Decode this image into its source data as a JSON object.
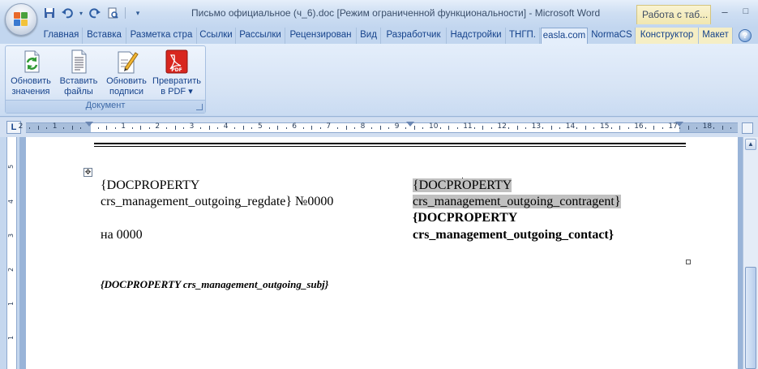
{
  "window": {
    "title": "Письмо официальное (ч_6).doc [Режим ограниченной функциональности] - Microsoft Word",
    "contextual_tab_header": "Работа с таб...",
    "controls": {
      "minimize": "–",
      "maximize": "□"
    }
  },
  "quick_access": [
    "save-icon",
    "undo-icon",
    "redo-icon",
    "print-preview-icon",
    "customize-icon"
  ],
  "tabs": [
    "Главная",
    "Вставка",
    "Разметка стра",
    "Ссылки",
    "Рассылки",
    "Рецензирован",
    "Вид",
    "Разработчик",
    "Надстройки",
    "ТНГП.",
    "easla.com",
    "NormaCS",
    "Конструктор",
    "Макет"
  ],
  "active_tab": "easla.com",
  "help_label": "?",
  "ribbon": {
    "group_label": "Документ",
    "buttons": [
      {
        "line1": "Обновить",
        "line2": "значения",
        "icon": "refresh-values-icon"
      },
      {
        "line1": "Вставить",
        "line2": "файлы",
        "icon": "insert-files-icon"
      },
      {
        "line1": "Обновить",
        "line2": "подписи",
        "icon": "update-signatures-icon"
      },
      {
        "line1": "Превратить",
        "line2": "в PDF ▾",
        "icon": "pdf-icon"
      }
    ]
  },
  "ruler": {
    "corner_label": "L",
    "numbers": [
      "2",
      "1",
      "1",
      "2",
      "3",
      "4",
      "5",
      "6",
      "7",
      "8",
      "9",
      "10",
      "11",
      "12",
      "13",
      "14",
      "15",
      "16",
      "17",
      "18"
    ],
    "vertical_numbers": [
      "5",
      "4",
      "3",
      "2",
      "1",
      "1",
      "2",
      "3",
      "4"
    ]
  },
  "document": {
    "left_line1": "{DOCPROPERTY",
    "left_line2": "crs_management_outgoing_regdate}  №0000",
    "left_line3": "на 0000",
    "right_line1_a": "{DOCPR",
    "right_line1_b": "OPERTY",
    "right_line2": "crs_management_outgoing_contragent}",
    "right_line3": "{DOCPROPERTY",
    "right_line4": "crs_management_outgoing_contact}",
    "subject": "{DOCPROPERTY  crs_management_outgoing_subj}"
  },
  "colors": {
    "tab_text": "#15428b",
    "field_highlight": "#c0c0c0",
    "pdf_red": "#d8261e"
  }
}
